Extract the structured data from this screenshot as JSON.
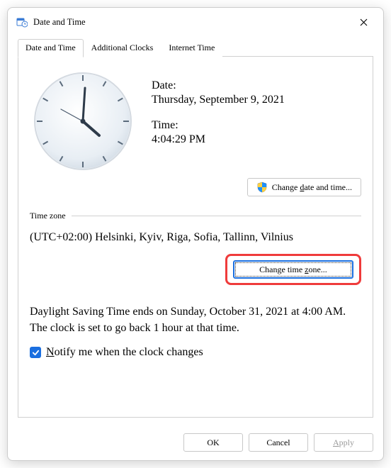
{
  "window": {
    "title": "Date and Time"
  },
  "tabs": [
    {
      "label": "Date and Time"
    },
    {
      "label": "Additional Clocks"
    },
    {
      "label": "Internet Time"
    }
  ],
  "datetime": {
    "date_label": "Date:",
    "date_value": "Thursday, September 9, 2021",
    "time_label": "Time:",
    "time_value": "4:04:29 PM",
    "change_button": "Change date and time..."
  },
  "timezone": {
    "legend": "Time zone",
    "value": "(UTC+02:00) Helsinki, Kyiv, Riga, Sofia, Tallinn, Vilnius",
    "change_button": "Change time zone..."
  },
  "dst": {
    "text": "Daylight Saving Time ends on Sunday, October 31, 2021 at 4:00 AM. The clock is set to go back 1 hour at that time.",
    "notify_label": "Notify me when the clock changes",
    "notify_checked": true
  },
  "footer": {
    "ok": "OK",
    "cancel": "Cancel",
    "apply": "Apply"
  }
}
